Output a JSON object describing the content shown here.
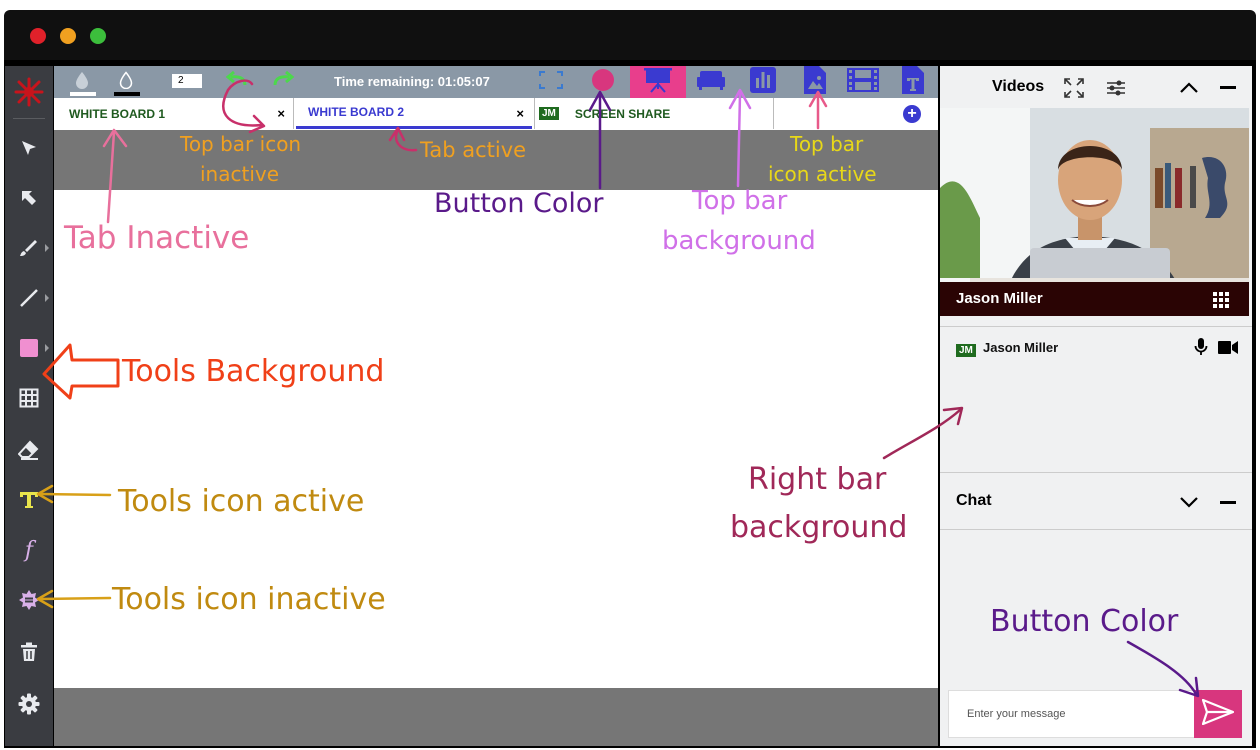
{
  "window": {
    "dot_colors": [
      "#e0212a",
      "#f0a020",
      "#3cbe3c"
    ]
  },
  "topbar": {
    "page_number": "2",
    "timer": "Time remaining: 01:05:07",
    "background": "#8a98a6",
    "button_color": "#d8367e",
    "icon_active_color": "#3a3ad0",
    "undo_redo_color": "#4cd84c"
  },
  "tabs": [
    {
      "label": "WHITE BOARD 1",
      "state": "inactive",
      "close": "×"
    },
    {
      "label": "WHITE BOARD 2",
      "state": "active",
      "close": "×"
    },
    {
      "label": "SCREEN SHARE",
      "badge": "JM",
      "state": "inactive"
    }
  ],
  "tools": [
    {
      "icon": "pointer-icon"
    },
    {
      "icon": "arrow-icon"
    },
    {
      "icon": "brush-icon"
    },
    {
      "icon": "line-icon"
    },
    {
      "icon": "rectangle-icon"
    },
    {
      "icon": "table-icon"
    },
    {
      "icon": "eraser-icon"
    },
    {
      "icon": "text-icon",
      "active": true
    },
    {
      "icon": "formula-icon"
    },
    {
      "icon": "badge-icon"
    },
    {
      "icon": "trash-icon"
    },
    {
      "icon": "settings-icon"
    }
  ],
  "right": {
    "videos_title": "Videos",
    "video_name": "Jason Miller",
    "participant": {
      "badge": "JM",
      "name": "Jason Miller"
    },
    "chat_title": "Chat",
    "chat_placeholder": "Enter your message"
  },
  "annotations": {
    "top_bar_icon_inactive_1": "Top bar icon",
    "top_bar_icon_inactive_2": "inactive",
    "tab_active": "Tab active",
    "button_color_top": "Button Color",
    "top_bar_background_1": "Top bar",
    "top_bar_background_2": "background",
    "top_bar_icon_active_1": "Top bar",
    "top_bar_icon_active_2": "icon active",
    "tab_inactive": "Tab Inactive",
    "tools_background": "Tools Background",
    "tools_icon_active": "Tools icon active",
    "tools_icon_inactive": "Tools icon inactive",
    "right_bar_background_1": "Right bar",
    "right_bar_background_2": "background",
    "button_color_bottom": "Button Color"
  }
}
